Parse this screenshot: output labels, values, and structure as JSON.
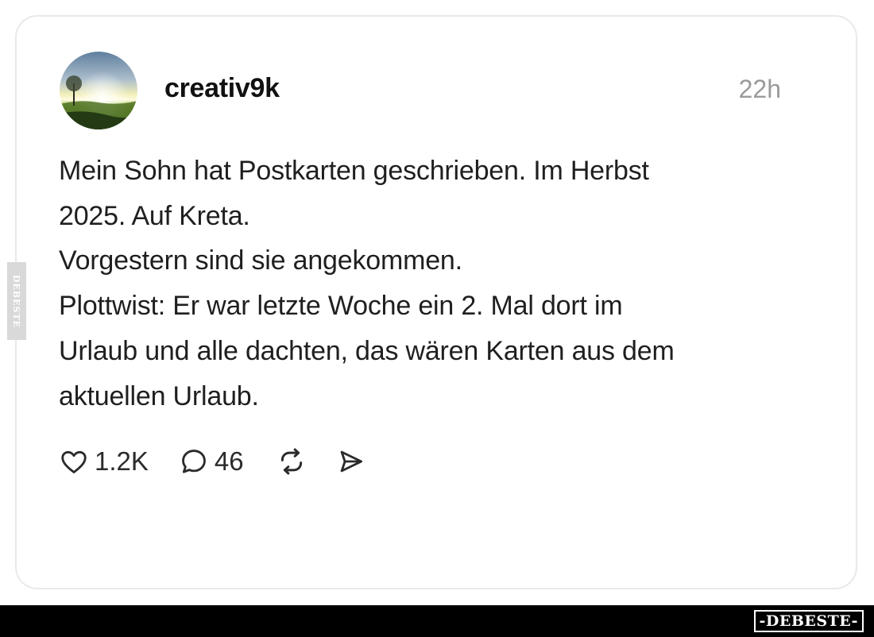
{
  "post": {
    "username": "creativ9k",
    "timestamp": "22h",
    "text_lines": [
      "Mein Sohn hat Postkarten geschrieben. Im Herbst",
      "2025. Auf Kreta.",
      "Vorgestern sind sie angekommen.",
      "Plottwist: Er war letzte Woche ein 2. Mal dort im",
      "Urlaub und alle dachten, das wären Karten aus dem",
      "aktuellen Urlaub."
    ],
    "actions": {
      "like_icon": "heart-icon",
      "like_count": "1.2K",
      "comment_icon": "comment-bubble-icon",
      "comment_count": "46",
      "repost_icon": "repost-icon",
      "share_icon": "send-icon"
    }
  },
  "watermark": {
    "side_text": "DEBESTE",
    "footer_text": "-DEBESTE-"
  },
  "colors": {
    "card_border": "#e9e9e9",
    "timestamp": "#9a9a9a",
    "text": "#1f1f1f",
    "footer_bar": "#000000"
  }
}
